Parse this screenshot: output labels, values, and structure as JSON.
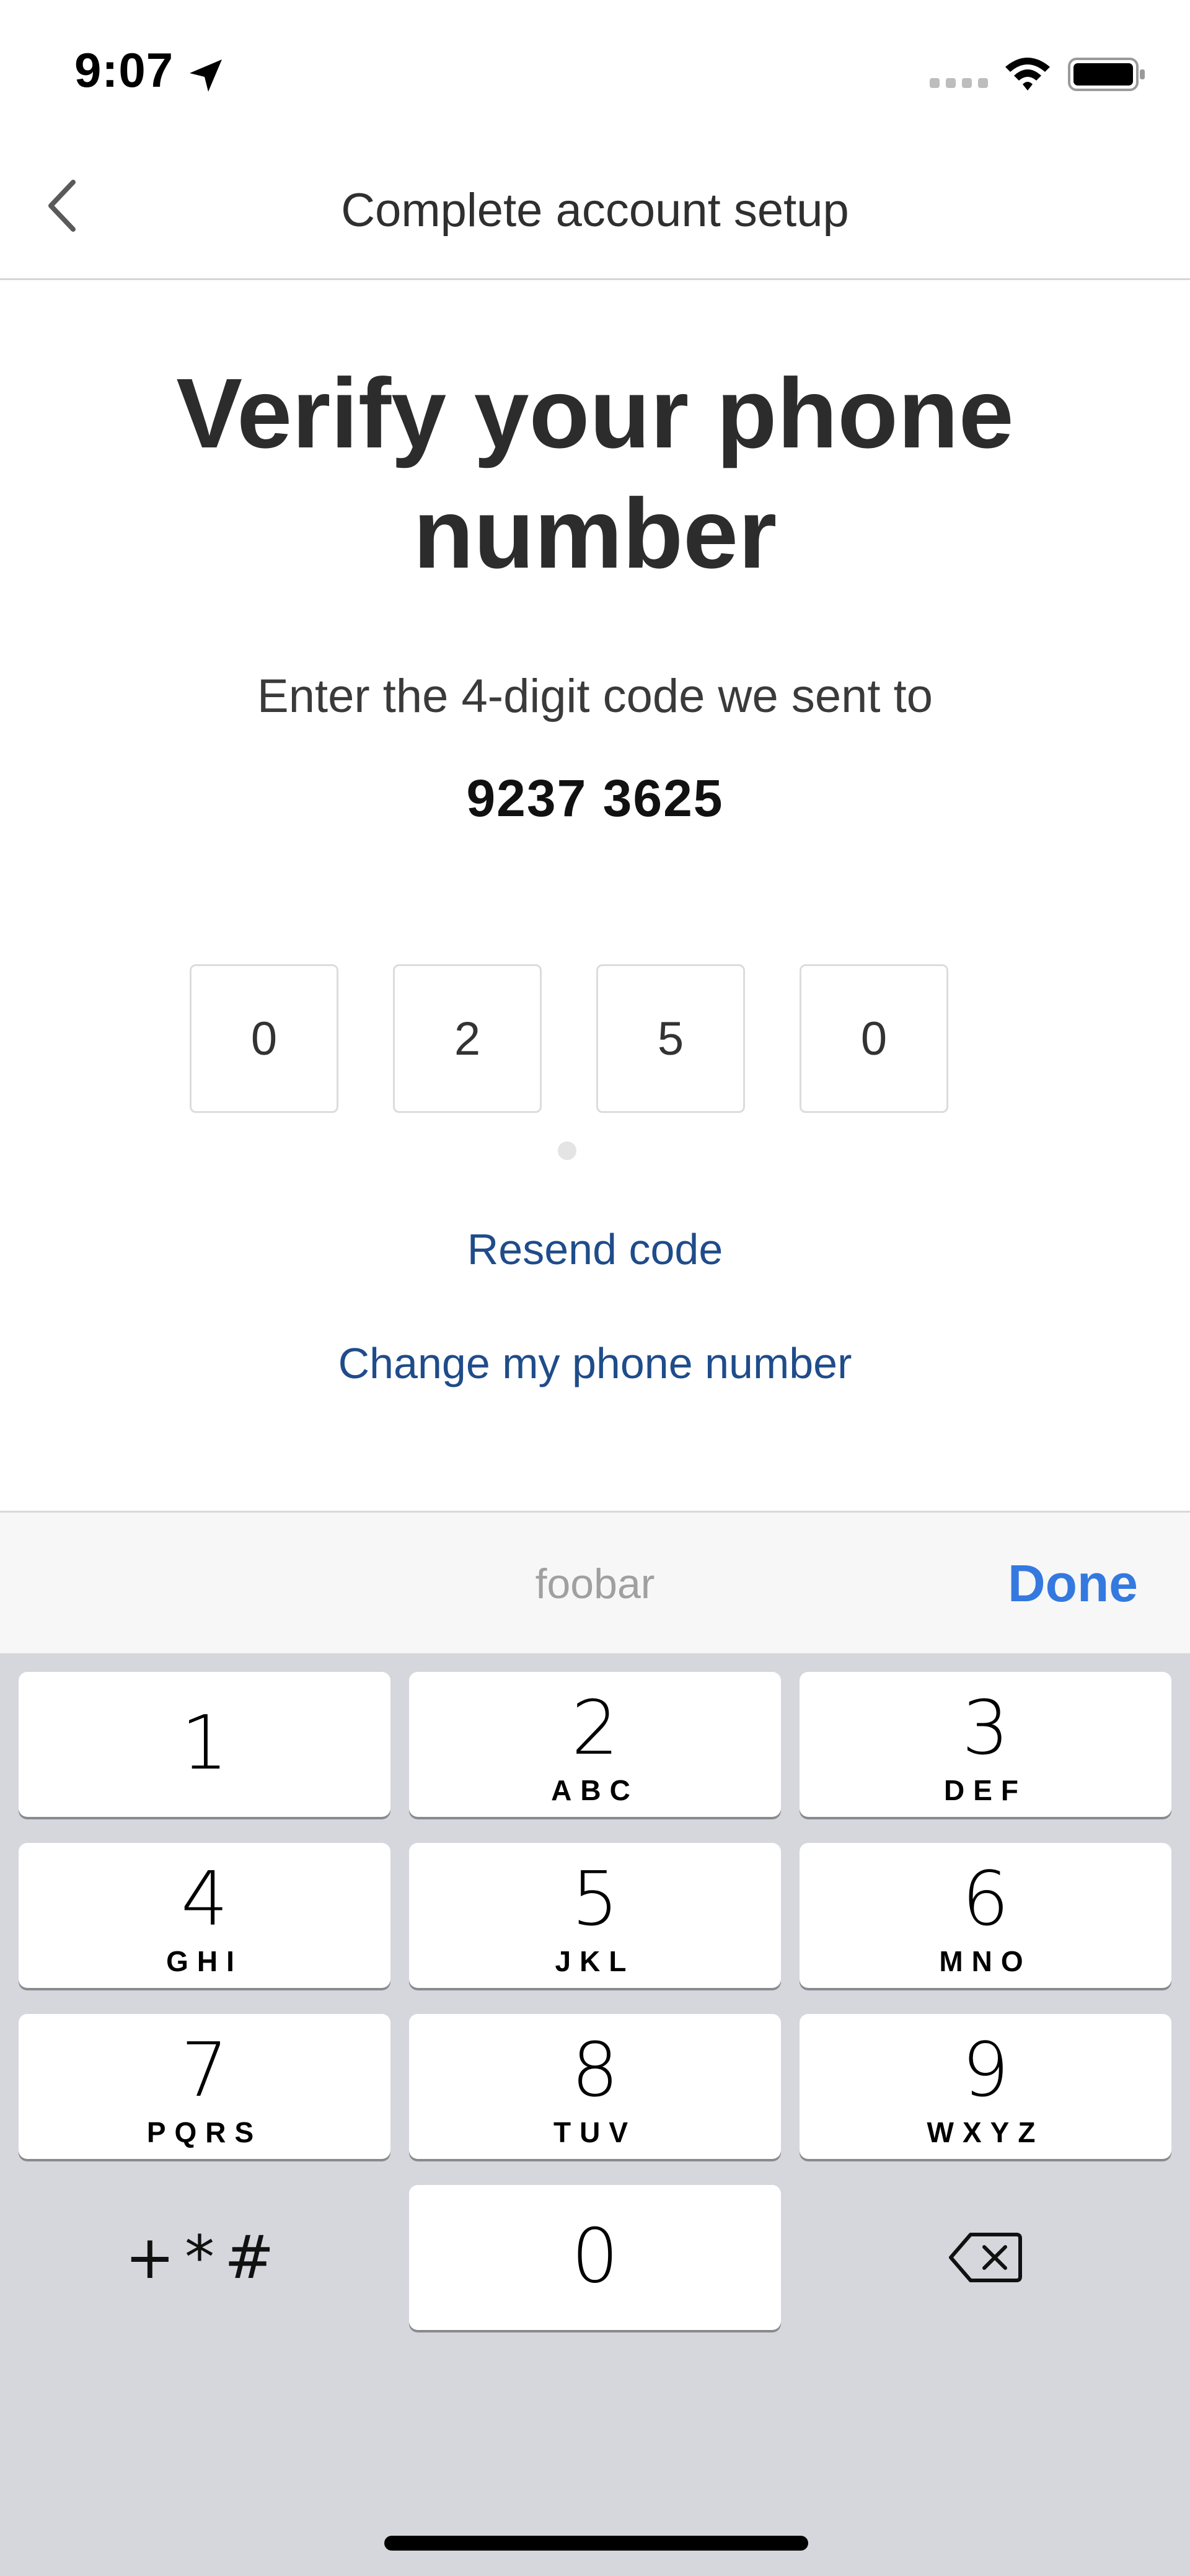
{
  "status_bar": {
    "time": "9:07",
    "icons": [
      "location-arrow-icon",
      "cell-signal-icon",
      "wifi-icon",
      "battery-icon"
    ]
  },
  "header": {
    "title": "Complete account setup",
    "back_icon": "chevron-left-icon"
  },
  "main": {
    "headline": "Verify your phone number",
    "subtext": "Enter the 4-digit code we sent to",
    "phone_number": "9237 3625",
    "code_digits": [
      "0",
      "2",
      "5",
      "0"
    ],
    "resend_label": "Resend code",
    "change_label": "Change my phone number"
  },
  "accessory": {
    "hint": "foobar",
    "done_label": "Done"
  },
  "keypad": {
    "keys": [
      {
        "digit": "1",
        "letters": ""
      },
      {
        "digit": "2",
        "letters": "ABC"
      },
      {
        "digit": "3",
        "letters": "DEF"
      },
      {
        "digit": "4",
        "letters": "GHI"
      },
      {
        "digit": "5",
        "letters": "JKL"
      },
      {
        "digit": "6",
        "letters": "MNO"
      },
      {
        "digit": "7",
        "letters": "PQRS"
      },
      {
        "digit": "8",
        "letters": "TUV"
      },
      {
        "digit": "9",
        "letters": "WXYZ"
      },
      {
        "digit": "0",
        "letters": ""
      }
    ],
    "symbols_label": "+*#",
    "delete_icon": "backspace-icon"
  },
  "colors": {
    "link": "#1f4c8a",
    "done": "#3479e0",
    "keypad_bg": "#d5d7dd"
  }
}
